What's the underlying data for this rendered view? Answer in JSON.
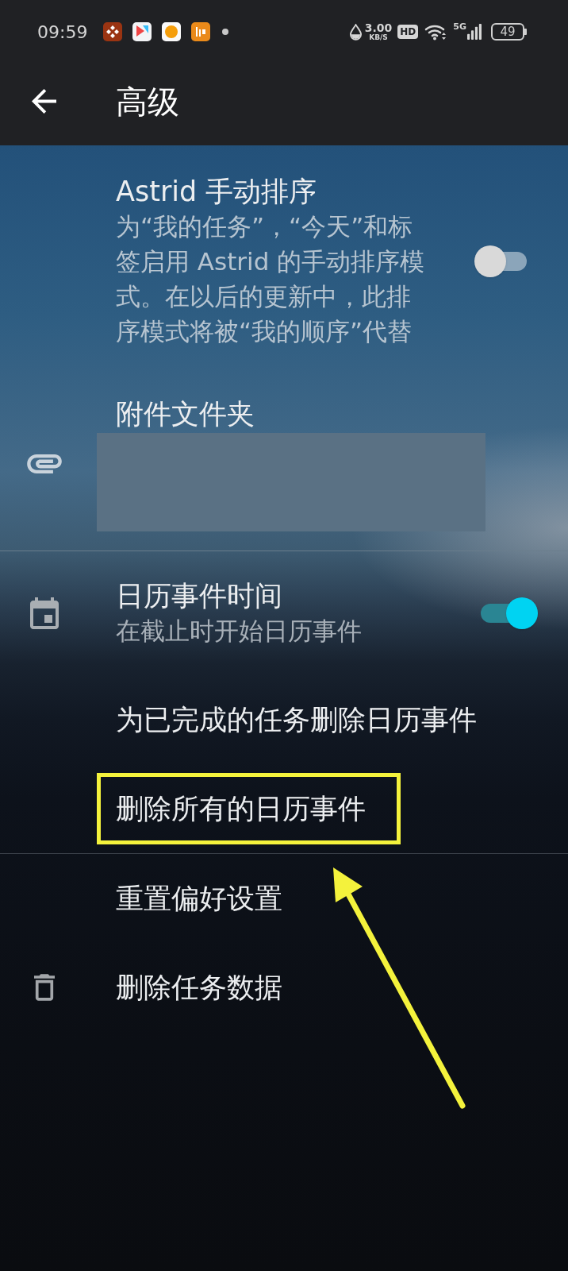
{
  "status_bar": {
    "time": "09:59",
    "speed": "3.00",
    "speed_unit": "KB/S",
    "hd": "HD",
    "network": "5G",
    "battery": "49"
  },
  "toolbar": {
    "title": "高级"
  },
  "sections": [
    {
      "items": [
        {
          "kind": "toggle",
          "title": "Astrid 手动排序",
          "summary": "为“我的任务”，“今天”和标签启用 Astrid 的手动排序模式。在以后的更新中，此排序模式将被“我的顺序”代替",
          "on": false,
          "highlighted": false
        },
        {
          "kind": "attachment",
          "title": "附件文件夹",
          "redacted": true,
          "highlighted": false
        }
      ]
    },
    {
      "items": [
        {
          "kind": "calendar",
          "title": "日历事件时间",
          "summary": "在截止时开始日历事件",
          "on": true,
          "highlighted": false
        },
        {
          "kind": "action",
          "title": "为已完成的任务删除日历事件",
          "highlighted": false
        },
        {
          "kind": "action",
          "title": "删除所有的日历事件",
          "highlighted": true
        }
      ]
    },
    {
      "items": [
        {
          "kind": "action",
          "title": "重置偏好设置",
          "highlighted": false
        },
        {
          "kind": "delete",
          "title": "删除任务数据",
          "highlighted": false
        }
      ]
    }
  ]
}
